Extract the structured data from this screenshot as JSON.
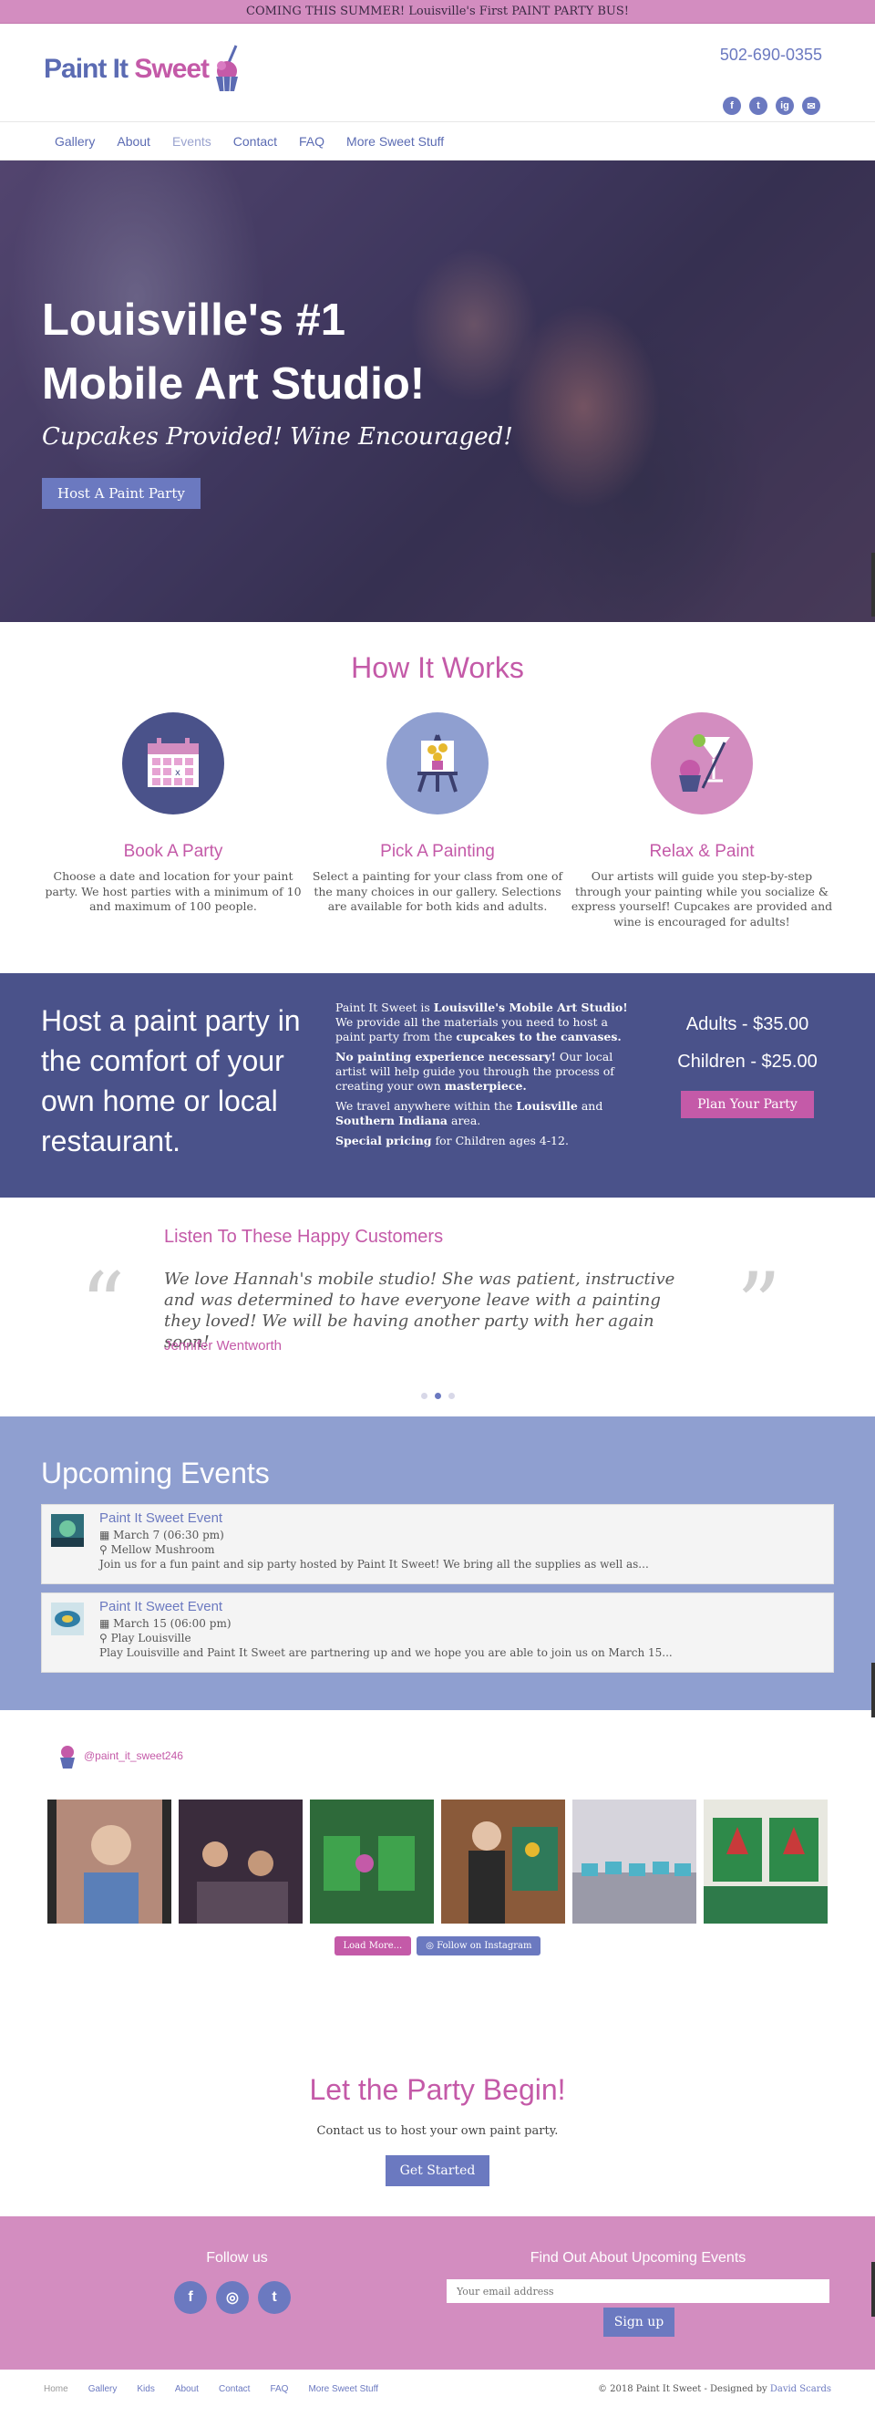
{
  "announcement": "COMING THIS SUMMER! Louisville's First PAINT PARTY BUS!",
  "header": {
    "logo_paint": "Paint It ",
    "logo_sweet": "Sweet",
    "phone": "502-690-0355",
    "social": [
      "f",
      "t",
      "ig",
      "✉"
    ]
  },
  "nav": [
    "Gallery",
    "About",
    "Events",
    "Contact",
    "FAQ",
    "More Sweet Stuff"
  ],
  "hero": {
    "line1": "Louisville's #1",
    "line2": "Mobile Art Studio!",
    "tagline": "Cupcakes Provided! Wine Encouraged!",
    "button": "Host A Paint Party"
  },
  "how": {
    "title": "How It Works",
    "steps": [
      {
        "title": "Book A Party",
        "text": "Choose a date and location for your paint party. We host parties with a minimum of 10 and maximum of 100 people."
      },
      {
        "title": "Pick A Painting",
        "text": "Select a painting for your class from one of the many choices in our gallery. Selections are available for both kids and adults."
      },
      {
        "title": "Relax & Paint",
        "text": "Our artists will guide you step-by-step through your painting while you socialize & express yourself! Cupcakes are provided and wine is encouraged for adults!"
      }
    ]
  },
  "pricing": {
    "headline": "Host a paint party in the comfort of your own home or local restaurant.",
    "p1_a": "Paint It Sweet is ",
    "p1_b": "Louisville's Mobile Art Studio!",
    "p1_c": " We provide all the materials you need to host a paint party from the ",
    "p1_d": "cupcakes to the canvases.",
    "p2_a": "No painting experience necessary!",
    "p2_b": " Our local artist will help guide you through the process of creating your own ",
    "p2_c": "masterpiece.",
    "p3_a": "We travel anywhere within the ",
    "p3_b": "Louisville",
    "p3_c": " and ",
    "p3_d": "Southern Indiana",
    "p3_e": " area.",
    "p4_a": "Special pricing",
    "p4_b": " for Children ages 4-12.",
    "adults": "Adults - $35.00",
    "children": "Children - $25.00",
    "button": "Plan Your Party"
  },
  "testimonial": {
    "title": "Listen To These Happy Customers",
    "text": "We love Hannah's mobile studio! She was patient, instructive and was determined to have everyone leave with a painting they loved! We will be having another party with her again soon!",
    "name": "Jennifer Wentworth"
  },
  "events": {
    "title": "Upcoming Events",
    "items": [
      {
        "title": "Paint It Sweet Event",
        "date": "March 7 (06:30 pm)",
        "location": "Mellow Mushroom",
        "desc": "Join us for a fun paint and sip party hosted by Paint It Sweet! We bring all the supplies as well as..."
      },
      {
        "title": "Paint It Sweet Event",
        "date": "March 15 (06:00 pm)",
        "location": "Play Louisville",
        "desc": "Play Louisville and Paint It Sweet are partnering up and we hope you are able to join us on March 15..."
      }
    ]
  },
  "instagram": {
    "handle": "@paint_it_sweet246",
    "load_more": "Load More...",
    "follow": "Follow on Instagram"
  },
  "cta": {
    "title": "Let the Party Begin!",
    "text": "Contact us to host your own paint party.",
    "button": "Get Started"
  },
  "footer": {
    "follow_title": "Follow us",
    "events_title": "Find Out About Upcoming Events",
    "email_placeholder": "Your email address",
    "signup": "Sign up"
  },
  "bottom": {
    "links": [
      "Home",
      "Gallery",
      "Kids",
      "About",
      "Contact",
      "FAQ",
      "More Sweet Stuff"
    ],
    "copyright": "© 2018 Paint It Sweet - Designed by ",
    "designer": "David Scards"
  },
  "colors": {
    "brand_pink": "#c45aa8",
    "brand_blue": "#6b79c0",
    "dark_blue": "#4a528a",
    "light_blue": "#8f9fd0",
    "footer_pink": "#d38dc0"
  }
}
